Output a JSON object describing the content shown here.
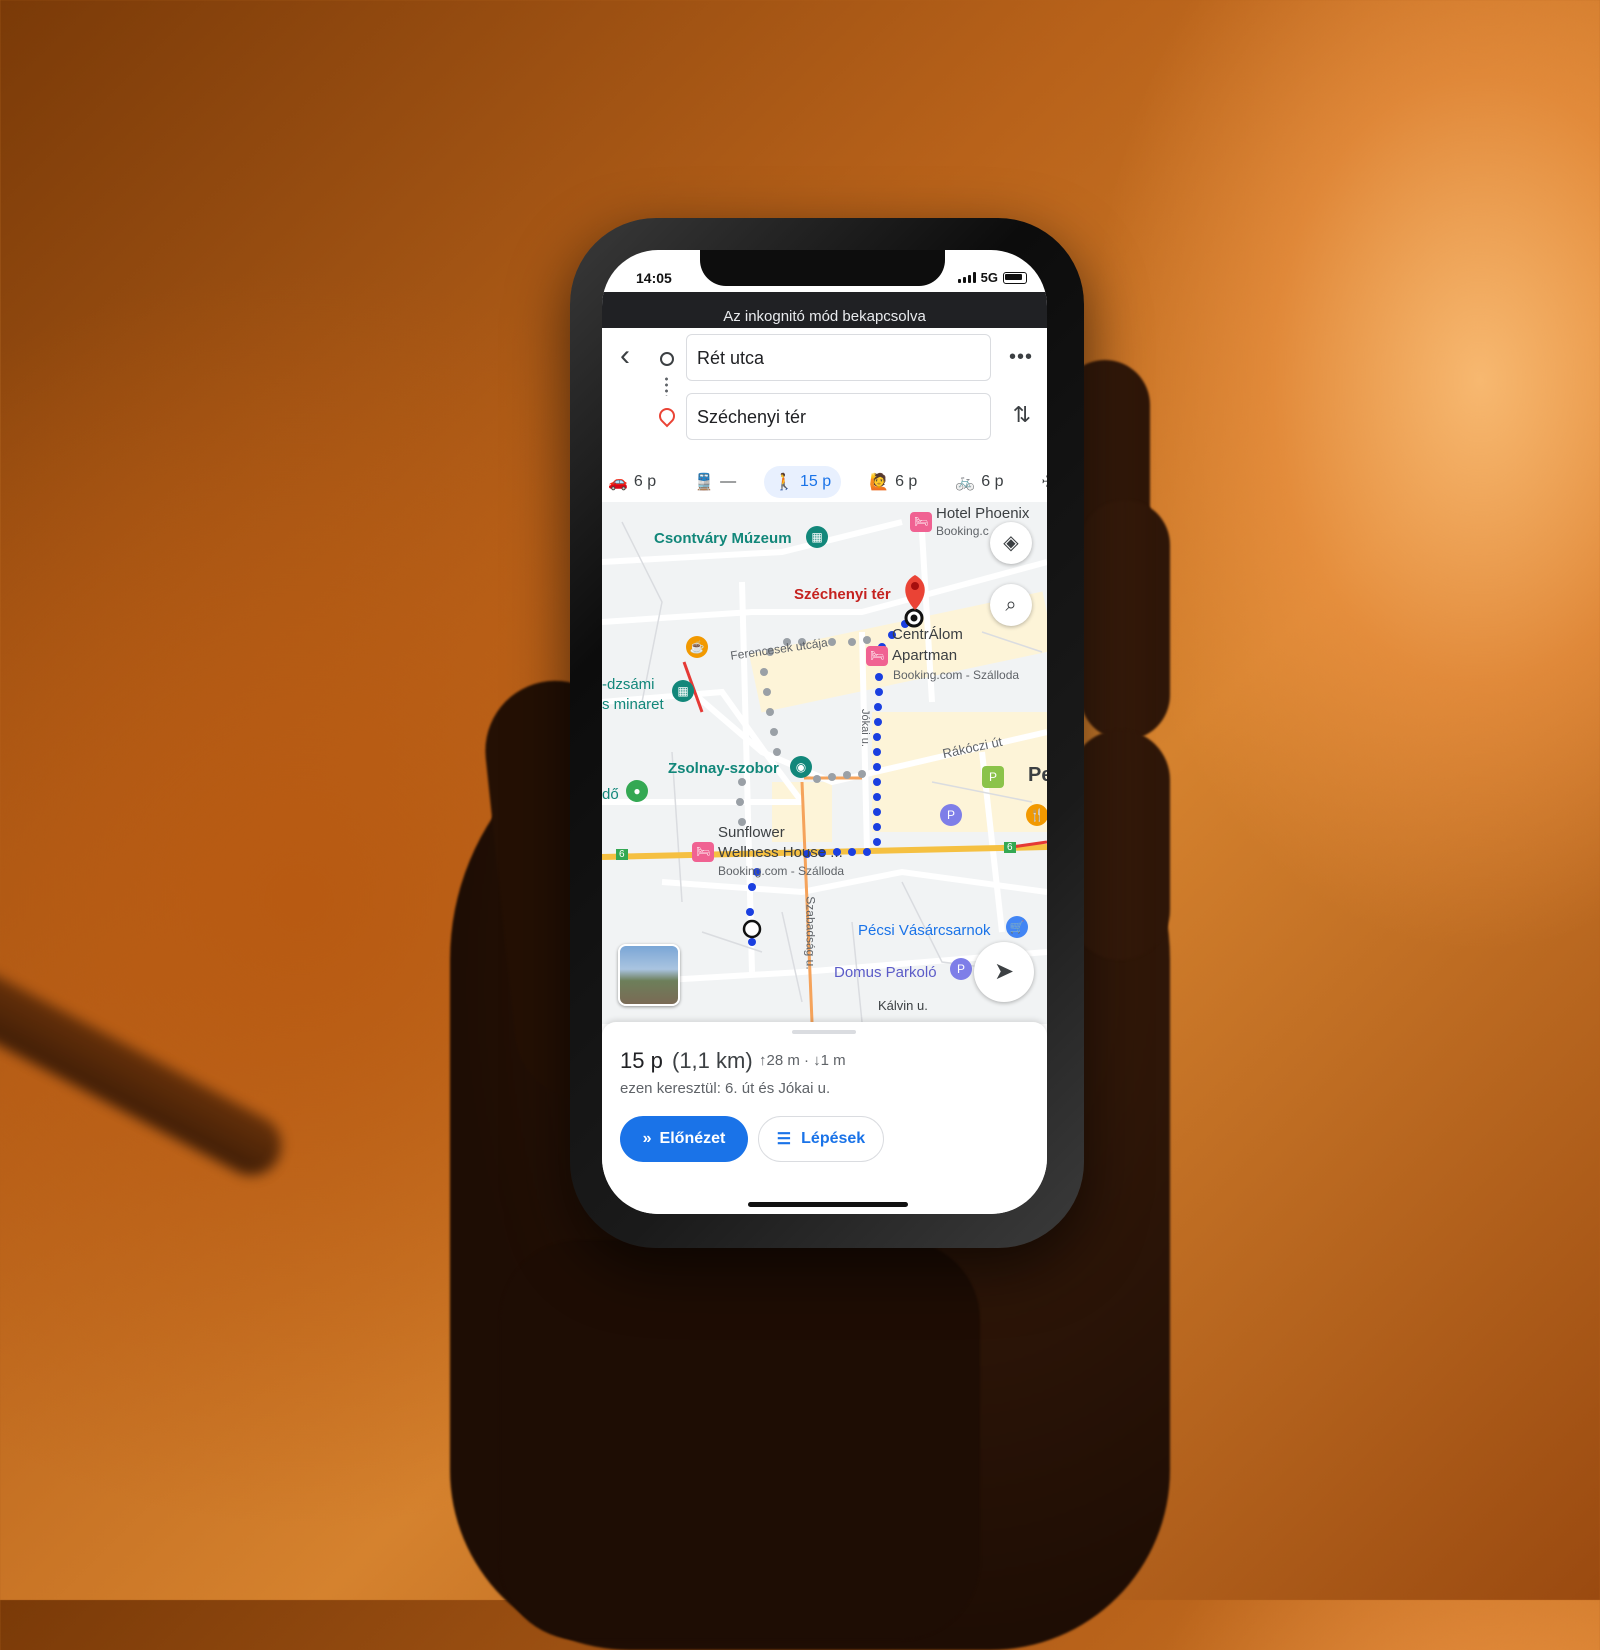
{
  "status": {
    "time": "14:05",
    "network": "5G"
  },
  "banner": "Az inkognitó mód bekapcsolva",
  "directions": {
    "origin": "Rét utca",
    "destination": "Széchenyi tér"
  },
  "modes": [
    {
      "icon": "car-icon",
      "label": "6 p"
    },
    {
      "icon": "transit-icon",
      "label": "—"
    },
    {
      "icon": "walk-icon",
      "label": "15 p",
      "active": true
    },
    {
      "icon": "ride-icon",
      "label": "6 p"
    },
    {
      "icon": "bike-icon",
      "label": "6 p"
    },
    {
      "icon": "flight-icon",
      "label": "—"
    }
  ],
  "map": {
    "labels": {
      "hotel_phoenix": "Hotel Phoenix",
      "booking_c": "Booking.c",
      "csontvary": "Csontváry Múzeum",
      "szechenyi": "Széchenyi tér",
      "centralom": "CentrÁlom",
      "apartman": "Apartman",
      "booking_szalloda": "Booking.com - Szálloda",
      "ferencesek": "Ferencesek utcája",
      "dzsami": "-dzsámi",
      "minaret": "s minaret",
      "zsolnay": "Zsolnay-szobor",
      "rakoczi": "Rákóczi út",
      "pe": "Pe",
      "do": "dő",
      "sunflower": "Sunflower",
      "wellness": "Wellness House ...",
      "booking_szalloda2": "Booking.com - Szálloda",
      "szabadsag": "Szabadság u.",
      "vasarcsarnok": "Pécsi Vásárcsarnok",
      "domus": "Domus Parkoló",
      "kalvin": "Kálvin u.",
      "jokai": "Jókai u.",
      "route6": "6",
      "route6b": "6"
    }
  },
  "summary": {
    "duration": "15 p",
    "distance": "(1,1 km)",
    "elevation": "↑28 m · ↓1 m",
    "via": "ezen keresztül: 6. út és Jókai u.",
    "preview_label": "Előnézet",
    "steps_label": "Lépések"
  }
}
